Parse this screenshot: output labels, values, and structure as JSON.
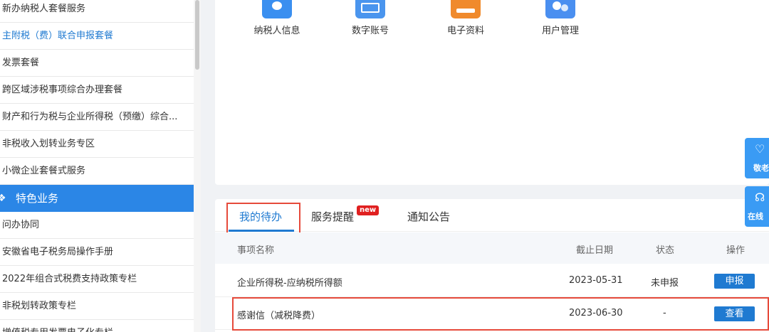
{
  "sidebar": {
    "items_top": [
      {
        "label": "新办纳税人套餐服务"
      },
      {
        "label": "主附税（费）联合申报套餐",
        "active": true
      },
      {
        "label": "发票套餐"
      },
      {
        "label": "跨区域涉税事项综合办理套餐"
      },
      {
        "label": "财产和行为税与企业所得税（预缴）综合..."
      },
      {
        "label": "非税收入划转业务专区"
      },
      {
        "label": "小微企业套餐式服务"
      }
    ],
    "section": {
      "label": "特色业务",
      "icon": "feature-icon"
    },
    "items_bottom": [
      {
        "label": "问办协同"
      },
      {
        "label": "安徽省电子税务局操作手册"
      },
      {
        "label": "2022年组合式税费支持政策专栏"
      },
      {
        "label": "非税划转政策专栏"
      },
      {
        "label": "增值税专用发票电子化专栏"
      }
    ]
  },
  "quick_access": [
    {
      "label": "纳税人信息",
      "icon": "taxpayer-info-icon",
      "color": "#3a8ff0"
    },
    {
      "label": "数字账号",
      "icon": "digital-account-icon",
      "color": "#4a95ee"
    },
    {
      "label": "电子资料",
      "icon": "e-documents-icon",
      "color": "#f08a2c"
    },
    {
      "label": "用户管理",
      "icon": "user-management-icon",
      "color": "#4a8ff0"
    }
  ],
  "tabs": [
    {
      "label": "我的待办",
      "active": true
    },
    {
      "label": "服务提醒",
      "badge": "new"
    },
    {
      "label": "通知公告"
    }
  ],
  "table": {
    "headers": {
      "name": "事项名称",
      "deadline": "截止日期",
      "status": "状态",
      "action": "操作"
    },
    "rows": [
      {
        "name": "企业所得税-应纳税所得额",
        "deadline": "2023-05-31",
        "status": "未申报",
        "action": "申报"
      },
      {
        "name": "感谢信（减税降费）",
        "deadline": "2023-06-30",
        "status": "-",
        "action": "查看"
      }
    ]
  },
  "float_widgets": [
    {
      "label": "敬老",
      "icon": "elderly-care-icon"
    },
    {
      "label": "在线",
      "icon": "online-service-icon"
    }
  ],
  "colors": {
    "accent": "#1f7ad1",
    "section_bg": "#2b86e6",
    "highlight_frame": "#e64a3b",
    "badge": "#e02020"
  }
}
